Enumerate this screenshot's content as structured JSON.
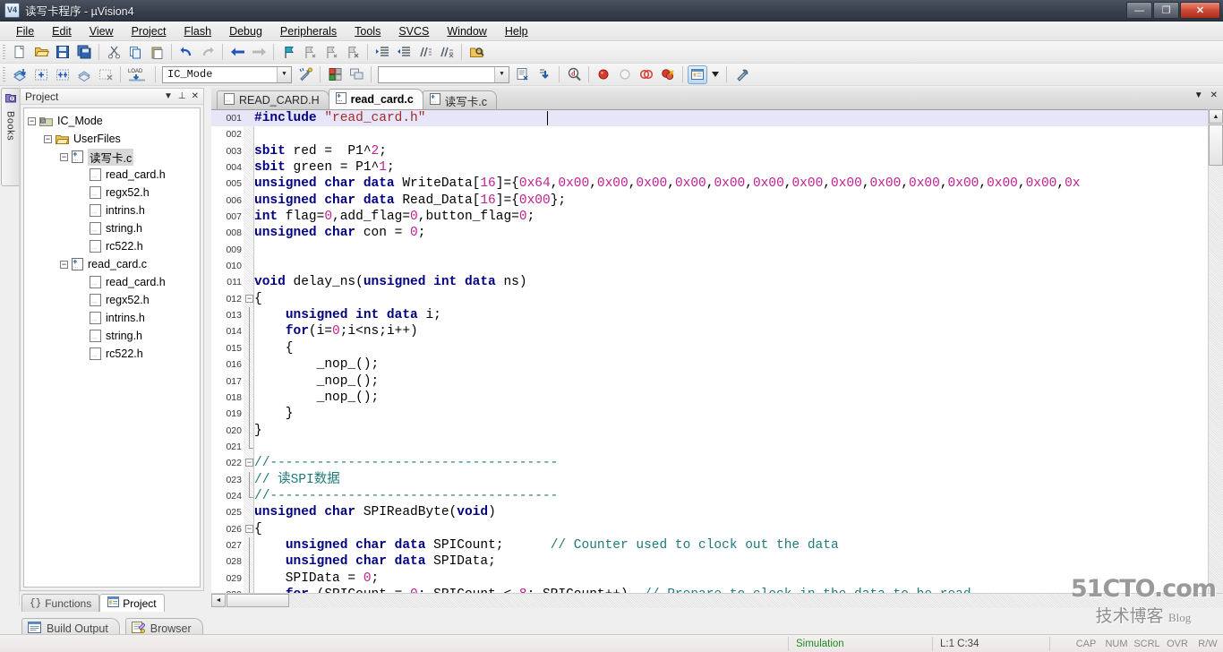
{
  "window": {
    "title": "读写卡程序 - µVision4",
    "app_icon": "uvision-logo-icon",
    "minimize": "—",
    "restore": "❐",
    "close": "✕"
  },
  "menubar": {
    "items": [
      {
        "label": "File"
      },
      {
        "label": "Edit"
      },
      {
        "label": "View"
      },
      {
        "label": "Project"
      },
      {
        "label": "Flash"
      },
      {
        "label": "Debug"
      },
      {
        "label": "Peripherals"
      },
      {
        "label": "Tools"
      },
      {
        "label": "SVCS"
      },
      {
        "label": "Window"
      },
      {
        "label": "Help"
      }
    ]
  },
  "toolbar_main": {
    "buttons": [
      {
        "name": "new-file-icon",
        "glyph": "🗋"
      },
      {
        "name": "open-file-icon",
        "glyph": "📂"
      },
      {
        "name": "save-icon",
        "glyph": "💾"
      },
      {
        "name": "save-all-icon",
        "glyph": "🗐"
      },
      {
        "name": "cut-icon",
        "glyph": "✂"
      },
      {
        "name": "copy-icon",
        "glyph": "⎘"
      },
      {
        "name": "paste-icon",
        "glyph": "📋"
      },
      {
        "name": "undo-icon",
        "glyph": "↺"
      },
      {
        "name": "redo-icon",
        "glyph": "↻"
      },
      {
        "name": "navigate-back-icon",
        "glyph": "⬅"
      },
      {
        "name": "navigate-forward-icon",
        "glyph": "➡"
      },
      {
        "name": "bookmark-toggle-icon",
        "glyph": "⚑"
      },
      {
        "name": "bookmark-prev-icon",
        "glyph": "⚐"
      },
      {
        "name": "bookmark-next-icon",
        "glyph": "⚐"
      },
      {
        "name": "bookmark-clear-icon",
        "glyph": "⚐"
      },
      {
        "name": "indent-icon",
        "glyph": "⇥"
      },
      {
        "name": "outdent-icon",
        "glyph": "⇤"
      },
      {
        "name": "comment-icon",
        "glyph": "∥"
      },
      {
        "name": "uncomment-icon",
        "glyph": "∦"
      },
      {
        "name": "find-in-files-icon",
        "glyph": "🔎"
      }
    ]
  },
  "toolbar_build": {
    "buttons": [
      {
        "name": "translate-icon",
        "glyph": "◈"
      },
      {
        "name": "build-target-icon",
        "glyph": "▦"
      },
      {
        "name": "rebuild-all-icon",
        "glyph": "▦"
      },
      {
        "name": "batch-build-icon",
        "glyph": "◆"
      },
      {
        "name": "stop-build-icon",
        "glyph": "▩"
      },
      {
        "name": "download-icon",
        "glyph": "LOAD"
      }
    ],
    "target_combo": {
      "name": "target-selector",
      "value": "IC_Mode",
      "arrow": "▼"
    },
    "buttons2": [
      {
        "name": "target-options-icon",
        "glyph": "🔧"
      },
      {
        "name": "manage-components-icon",
        "glyph": "▣"
      },
      {
        "name": "multi-project-icon",
        "glyph": "▤"
      }
    ],
    "file_combo": {
      "name": "file-selector",
      "value": "",
      "arrow": "▼"
    },
    "buttons3": [
      {
        "name": "source-browse-icon",
        "glyph": "▤"
      },
      {
        "name": "goto-definition-icon",
        "glyph": "⤵"
      },
      {
        "name": "find-icon",
        "glyph": "🔍"
      },
      {
        "name": "insert-breakpoint-icon",
        "glyph": "●"
      },
      {
        "name": "kill-breakpoint-icon",
        "glyph": "○"
      },
      {
        "name": "disable-breakpoint-icon",
        "glyph": "◌"
      },
      {
        "name": "kill-all-breakpoints-icon",
        "glyph": "●"
      },
      {
        "name": "project-window-icon",
        "glyph": "▥"
      },
      {
        "name": "toolbox-dropdown-icon",
        "glyph": "▼"
      },
      {
        "name": "configuration-wizard-icon",
        "glyph": "🔧"
      }
    ]
  },
  "sidebar_strip": {
    "books_tab": {
      "label": "Books",
      "icon": "books-icon"
    }
  },
  "project_panel": {
    "title": "Project",
    "header_buttons": [
      {
        "name": "panel-menu-icon",
        "glyph": "▼"
      },
      {
        "name": "panel-pin-icon",
        "glyph": "⊥"
      },
      {
        "name": "panel-close-icon",
        "glyph": "✕"
      }
    ],
    "tree": [
      {
        "depth": 0,
        "expander": "−",
        "icon": "project-target-icon",
        "label": "IC_Mode",
        "selected": false
      },
      {
        "depth": 1,
        "expander": "−",
        "icon": "folder-icon",
        "label": "UserFiles",
        "selected": false
      },
      {
        "depth": 2,
        "expander": "−",
        "icon": "c-source-icon",
        "label": "读写卡.c",
        "selected": true
      },
      {
        "depth": 3,
        "expander": "",
        "icon": "header-file-icon",
        "label": "read_card.h",
        "selected": false
      },
      {
        "depth": 3,
        "expander": "",
        "icon": "header-file-icon",
        "label": "regx52.h",
        "selected": false
      },
      {
        "depth": 3,
        "expander": "",
        "icon": "header-file-icon",
        "label": "intrins.h",
        "selected": false
      },
      {
        "depth": 3,
        "expander": "",
        "icon": "header-file-icon",
        "label": "string.h",
        "selected": false
      },
      {
        "depth": 3,
        "expander": "",
        "icon": "header-file-icon",
        "label": "rc522.h",
        "selected": false
      },
      {
        "depth": 2,
        "expander": "−",
        "icon": "c-source-icon",
        "label": "read_card.c",
        "selected": false
      },
      {
        "depth": 3,
        "expander": "",
        "icon": "header-file-icon",
        "label": "read_card.h",
        "selected": false
      },
      {
        "depth": 3,
        "expander": "",
        "icon": "header-file-icon",
        "label": "regx52.h",
        "selected": false
      },
      {
        "depth": 3,
        "expander": "",
        "icon": "header-file-icon",
        "label": "intrins.h",
        "selected": false
      },
      {
        "depth": 3,
        "expander": "",
        "icon": "header-file-icon",
        "label": "string.h",
        "selected": false
      },
      {
        "depth": 3,
        "expander": "",
        "icon": "header-file-icon",
        "label": "rc522.h",
        "selected": false
      }
    ],
    "tabs": [
      {
        "label": "Functions",
        "icon": "braces-icon",
        "active": false
      },
      {
        "label": "Project",
        "icon": "project-icon",
        "active": true
      }
    ]
  },
  "editor": {
    "tabs": [
      {
        "label": "READ_CARD.H",
        "icon": "header-file-icon",
        "active": false
      },
      {
        "label": "read_card.c",
        "icon": "c-source-icon",
        "active": true
      },
      {
        "label": "读写卡.c",
        "icon": "c-source-icon",
        "active": false
      }
    ],
    "tab_dropdown": "▼",
    "tab_close": "✕",
    "cursor_line": 1,
    "lines": [
      {
        "num": "001",
        "fold": "",
        "current": true,
        "tokens": [
          {
            "t": "#include ",
            "c": "k"
          },
          {
            "t": "\"read_card.h\"",
            "c": "s"
          }
        ]
      },
      {
        "num": "002",
        "fold": "",
        "tokens": []
      },
      {
        "num": "003",
        "fold": "",
        "tokens": [
          {
            "t": "sbit",
            "c": "k"
          },
          {
            "t": " red =  P1^",
            "c": "id"
          },
          {
            "t": "2",
            "c": "n"
          },
          {
            "t": ";",
            "c": "id"
          }
        ]
      },
      {
        "num": "004",
        "fold": "",
        "tokens": [
          {
            "t": "sbit",
            "c": "k"
          },
          {
            "t": " green = P1^",
            "c": "id"
          },
          {
            "t": "1",
            "c": "n"
          },
          {
            "t": ";",
            "c": "id"
          }
        ]
      },
      {
        "num": "005",
        "fold": "",
        "tokens": [
          {
            "t": "unsigned char data",
            "c": "k"
          },
          {
            "t": " WriteData[",
            "c": "id"
          },
          {
            "t": "16",
            "c": "n"
          },
          {
            "t": "]={",
            "c": "id"
          },
          {
            "t": "0x64",
            "c": "n"
          },
          {
            "t": ",",
            "c": "id"
          },
          {
            "t": "0x00",
            "c": "n"
          },
          {
            "t": ",",
            "c": "id"
          },
          {
            "t": "0x00",
            "c": "n"
          },
          {
            "t": ",",
            "c": "id"
          },
          {
            "t": "0x00",
            "c": "n"
          },
          {
            "t": ",",
            "c": "id"
          },
          {
            "t": "0x00",
            "c": "n"
          },
          {
            "t": ",",
            "c": "id"
          },
          {
            "t": "0x00",
            "c": "n"
          },
          {
            "t": ",",
            "c": "id"
          },
          {
            "t": "0x00",
            "c": "n"
          },
          {
            "t": ",",
            "c": "id"
          },
          {
            "t": "0x00",
            "c": "n"
          },
          {
            "t": ",",
            "c": "id"
          },
          {
            "t": "0x00",
            "c": "n"
          },
          {
            "t": ",",
            "c": "id"
          },
          {
            "t": "0x00",
            "c": "n"
          },
          {
            "t": ",",
            "c": "id"
          },
          {
            "t": "0x00",
            "c": "n"
          },
          {
            "t": ",",
            "c": "id"
          },
          {
            "t": "0x00",
            "c": "n"
          },
          {
            "t": ",",
            "c": "id"
          },
          {
            "t": "0x00",
            "c": "n"
          },
          {
            "t": ",",
            "c": "id"
          },
          {
            "t": "0x00",
            "c": "n"
          },
          {
            "t": ",",
            "c": "id"
          },
          {
            "t": "0x",
            "c": "n"
          }
        ]
      },
      {
        "num": "006",
        "fold": "",
        "tokens": [
          {
            "t": "unsigned char data",
            "c": "k"
          },
          {
            "t": " Read_Data[",
            "c": "id"
          },
          {
            "t": "16",
            "c": "n"
          },
          {
            "t": "]={",
            "c": "id"
          },
          {
            "t": "0x00",
            "c": "n"
          },
          {
            "t": "};",
            "c": "id"
          }
        ]
      },
      {
        "num": "007",
        "fold": "",
        "tokens": [
          {
            "t": "int",
            "c": "k"
          },
          {
            "t": " flag=",
            "c": "id"
          },
          {
            "t": "0",
            "c": "n"
          },
          {
            "t": ",add_flag=",
            "c": "id"
          },
          {
            "t": "0",
            "c": "n"
          },
          {
            "t": ",button_flag=",
            "c": "id"
          },
          {
            "t": "0",
            "c": "n"
          },
          {
            "t": ";",
            "c": "id"
          }
        ]
      },
      {
        "num": "008",
        "fold": "",
        "tokens": [
          {
            "t": "unsigned char",
            "c": "k"
          },
          {
            "t": " con = ",
            "c": "id"
          },
          {
            "t": "0",
            "c": "n"
          },
          {
            "t": ";",
            "c": "id"
          }
        ]
      },
      {
        "num": "009",
        "fold": "",
        "tokens": []
      },
      {
        "num": "010",
        "fold": "",
        "tokens": []
      },
      {
        "num": "011",
        "fold": "",
        "tokens": [
          {
            "t": "void",
            "c": "k"
          },
          {
            "t": " delay_ns(",
            "c": "id"
          },
          {
            "t": "unsigned int data",
            "c": "k"
          },
          {
            "t": " ns)",
            "c": "id"
          }
        ]
      },
      {
        "num": "012",
        "fold": "minus",
        "tokens": [
          {
            "t": "{",
            "c": "id"
          }
        ]
      },
      {
        "num": "013",
        "fold": "bar",
        "tokens": [
          {
            "t": "    ",
            "c": "id"
          },
          {
            "t": "unsigned int data",
            "c": "k"
          },
          {
            "t": " i;",
            "c": "id"
          }
        ]
      },
      {
        "num": "014",
        "fold": "bar",
        "tokens": [
          {
            "t": "    ",
            "c": "id"
          },
          {
            "t": "for",
            "c": "k"
          },
          {
            "t": "(i=",
            "c": "id"
          },
          {
            "t": "0",
            "c": "n"
          },
          {
            "t": ";i<ns;i++)",
            "c": "id"
          }
        ]
      },
      {
        "num": "015",
        "fold": "bar",
        "tokens": [
          {
            "t": "    {",
            "c": "id"
          }
        ]
      },
      {
        "num": "016",
        "fold": "bar",
        "tokens": [
          {
            "t": "        _nop_();",
            "c": "id"
          }
        ]
      },
      {
        "num": "017",
        "fold": "bar",
        "tokens": [
          {
            "t": "        _nop_();",
            "c": "id"
          }
        ]
      },
      {
        "num": "018",
        "fold": "bar",
        "tokens": [
          {
            "t": "        _nop_();",
            "c": "id"
          }
        ]
      },
      {
        "num": "019",
        "fold": "bar",
        "tokens": [
          {
            "t": "    }",
            "c": "id"
          }
        ]
      },
      {
        "num": "020",
        "fold": "bar",
        "tokens": [
          {
            "t": "}",
            "c": "id"
          }
        ]
      },
      {
        "num": "021",
        "fold": "end",
        "tokens": []
      },
      {
        "num": "022",
        "fold": "minus",
        "tokens": [
          {
            "t": "//-------------------------------------",
            "c": "c"
          }
        ]
      },
      {
        "num": "023",
        "fold": "bar",
        "tokens": [
          {
            "t": "// 读SPI数据",
            "c": "c"
          }
        ]
      },
      {
        "num": "024",
        "fold": "end",
        "tokens": [
          {
            "t": "//-------------------------------------",
            "c": "c"
          }
        ]
      },
      {
        "num": "025",
        "fold": "",
        "tokens": [
          {
            "t": "unsigned char",
            "c": "k"
          },
          {
            "t": " SPIReadByte(",
            "c": "id"
          },
          {
            "t": "void",
            "c": "k"
          },
          {
            "t": ")",
            "c": "id"
          }
        ]
      },
      {
        "num": "026",
        "fold": "minus",
        "tokens": [
          {
            "t": "{",
            "c": "id"
          }
        ]
      },
      {
        "num": "027",
        "fold": "bar",
        "tokens": [
          {
            "t": "    ",
            "c": "id"
          },
          {
            "t": "unsigned char data",
            "c": "k"
          },
          {
            "t": " SPICount;      ",
            "c": "id"
          },
          {
            "t": "// Counter used to clock out the data",
            "c": "c"
          }
        ]
      },
      {
        "num": "028",
        "fold": "bar",
        "tokens": [
          {
            "t": "    ",
            "c": "id"
          },
          {
            "t": "unsigned char data",
            "c": "k"
          },
          {
            "t": " SPIData;",
            "c": "id"
          }
        ]
      },
      {
        "num": "029",
        "fold": "bar",
        "tokens": [
          {
            "t": "    SPIData = ",
            "c": "id"
          },
          {
            "t": "0",
            "c": "n"
          },
          {
            "t": ";",
            "c": "id"
          }
        ]
      },
      {
        "num": "030",
        "fold": "bar",
        "tokens": [
          {
            "t": "    ",
            "c": "id"
          },
          {
            "t": "for",
            "c": "k"
          },
          {
            "t": " (SPICount = ",
            "c": "id"
          },
          {
            "t": "0",
            "c": "n"
          },
          {
            "t": "; SPICount < ",
            "c": "id"
          },
          {
            "t": "8",
            "c": "n"
          },
          {
            "t": "; SPICount++)  ",
            "c": "id"
          },
          {
            "t": "// Prepare to clock in the data to be read",
            "c": "c"
          }
        ]
      }
    ],
    "hscroll": {
      "left_arrow": "◄",
      "right_arrow": "►"
    },
    "vscroll": {
      "up_arrow": "▲",
      "down_arrow": "▼"
    }
  },
  "dock_tabs": [
    {
      "label": "Build Output",
      "icon": "build-output-icon"
    },
    {
      "label": "Browser",
      "icon": "browser-icon"
    }
  ],
  "statusbar": {
    "message": "",
    "simulation": "Simulation",
    "position": "L:1 C:34",
    "indicators": [
      "CAP",
      "NUM",
      "SCRL",
      "OVR",
      "R/W"
    ]
  },
  "watermark": {
    "main": "51CTO.com",
    "sub_cn": "技术博客",
    "sub_en": "Blog"
  },
  "colors": {
    "keyword": "#000080",
    "string": "#a52a2a",
    "number": "#c02090",
    "comment": "#1f7a7a",
    "current_line": "#e6e6f8",
    "simulation_green": "#1f8b1f",
    "titlebar": "#3b4250"
  }
}
